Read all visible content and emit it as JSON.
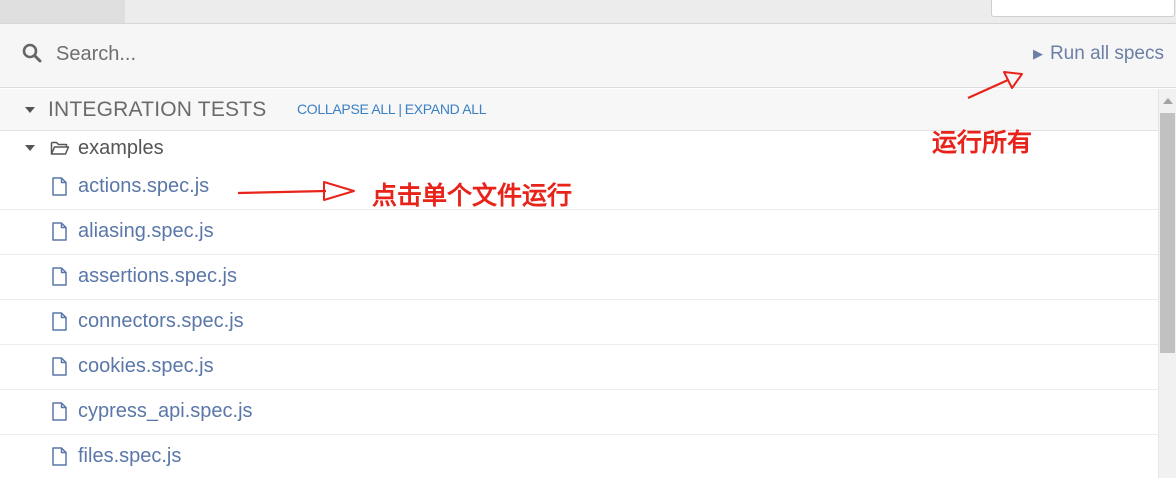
{
  "search": {
    "placeholder": "Search...",
    "value": ""
  },
  "toolbar": {
    "run_all_label": "Run all specs",
    "run_all_icon": "play-icon"
  },
  "section": {
    "title": "INTEGRATION TESTS",
    "collapse_all": "COLLAPSE ALL",
    "separator": "|",
    "expand_all": "EXPAND ALL"
  },
  "folder": {
    "name": "examples",
    "expanded": true
  },
  "files": [
    "actions.spec.js",
    "aliasing.spec.js",
    "assertions.spec.js",
    "connectors.spec.js",
    "cookies.spec.js",
    "cypress_api.spec.js",
    "files.spec.js"
  ],
  "annotations": {
    "run_all": "运行所有",
    "run_single": "点击单个文件运行"
  },
  "colors": {
    "link": "#3b7fc4",
    "file_text": "#5a77a8",
    "annotation": "#e8231a"
  }
}
